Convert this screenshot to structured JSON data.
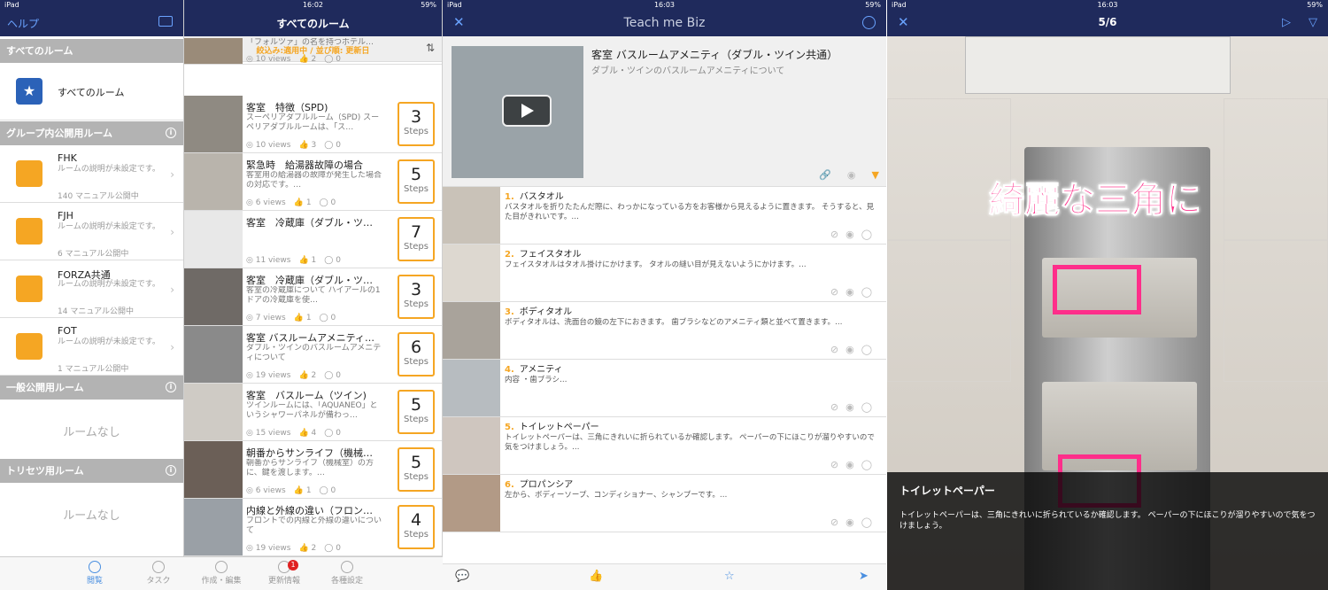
{
  "status": {
    "device": "iPad",
    "battery": "59%",
    "times": [
      "16:02",
      "16:03",
      "16:03"
    ]
  },
  "p1": {
    "help": "ヘルプ",
    "sections": {
      "all": "すべてのルーム",
      "group": "グループ内公開用ルーム",
      "public": "一般公開用ルーム",
      "torisetsu": "トリセツ用ルーム"
    },
    "all_room": "すべてのルーム",
    "rooms": [
      {
        "name": "FHK",
        "desc": "ルームの説明が未設定です。",
        "meta": "140 マニュアル公開中"
      },
      {
        "name": "FJH",
        "desc": "ルームの説明が未設定です。",
        "meta": "6 マニュアル公開中"
      },
      {
        "name": "FORZA共通",
        "desc": "ルームの説明が未設定です。",
        "meta": "14 マニュアル公開中"
      },
      {
        "name": "FOT",
        "desc": "ルームの説明が未設定です。",
        "meta": "1 マニュアル公開中"
      }
    ],
    "no_room": "ルームなし"
  },
  "tabs": [
    {
      "label": "閲覧"
    },
    {
      "label": "タスク"
    },
    {
      "label": "作成・編集"
    },
    {
      "label": "更新情報",
      "badge": "1"
    },
    {
      "label": "各種設定"
    }
  ],
  "p2": {
    "title": "すべてのルーム",
    "filter": "絞込み:適用中 / 並び順: 更新日",
    "steps_label": "Steps",
    "manuals": [
      {
        "title": "",
        "desc": "「フォルツァ」の名を持つホテル…",
        "views": "10 views",
        "likes": "2",
        "comments": "0"
      },
      {
        "title": "客室　特徴（SPD)",
        "desc": "スーペリアダブルルーム（SPD) スーペリアダブルルームは、「ス…",
        "views": "10 views",
        "likes": "3",
        "comments": "0",
        "steps": "3"
      },
      {
        "title": "緊急時　給湯器故障の場合",
        "desc": "客室用の給湯器の故障が発生した場合の対応です。…",
        "views": "6 views",
        "likes": "1",
        "comments": "0",
        "steps": "5"
      },
      {
        "title": "客室　冷蔵庫（ダブル・ツ…",
        "desc": "",
        "views": "11 views",
        "likes": "1",
        "comments": "0",
        "steps": "7"
      },
      {
        "title": "客室　冷蔵庫（ダブル・ツ…",
        "desc": "客室の冷蔵庫について ハイアールの1ドアの冷蔵庫を使…",
        "views": "7 views",
        "likes": "1",
        "comments": "0",
        "steps": "3"
      },
      {
        "title": "客室 バスルームアメニティ…",
        "desc": "ダブル・ツインのバスルームアメニティについて",
        "views": "19 views",
        "likes": "2",
        "comments": "0",
        "steps": "6"
      },
      {
        "title": "客室　バスルーム（ツイン)",
        "desc": "ツインルームには、「AQUANEO」というシャワーパネルが備わっ…",
        "views": "15 views",
        "likes": "4",
        "comments": "0",
        "steps": "5"
      },
      {
        "title": "朝番からサンライフ（機械…",
        "desc": "朝番からサンライフ（機械室）の方に、鍵を渡します。…",
        "views": "6 views",
        "likes": "1",
        "comments": "0",
        "steps": "5"
      },
      {
        "title": "内線と外線の違い（フロン…",
        "desc": "フロントでの内線と外線の違いについて",
        "views": "19 views",
        "likes": "2",
        "comments": "0",
        "steps": "4"
      }
    ]
  },
  "p3": {
    "logo": "Teach me Biz",
    "title": "客室 バスルームアメニティ（ダブル・ツイン共通）",
    "subtitle": "ダブル・ツインのバスルームアメニティについて",
    "steps": [
      {
        "num": "1.",
        "title": "バスタオル",
        "desc": "バスタオルを折りたたんだ際に、わっかになっている方をお客様から見えるように置きます。 そうすると、見た目がきれいです。…"
      },
      {
        "num": "2.",
        "title": "フェイスタオル",
        "desc": "フェイスタオルはタオル掛けにかけます。 タオルの縫い目が見えないようにかけます。…"
      },
      {
        "num": "3.",
        "title": "ボディタオル",
        "desc": "ボディタオルは、洗面台の鏡の左下におきます。 歯ブラシなどのアメニティ類と並べて置きます。…"
      },
      {
        "num": "4.",
        "title": "アメニティ",
        "desc": "内容 ・歯ブラシ…"
      },
      {
        "num": "5.",
        "title": "トイレットペーパー",
        "desc": "トイレットペーパーは、三角にきれいに折られているか確認します。 ペーパーの下にほこりが溜りやすいので気をつけましょう。…"
      },
      {
        "num": "6.",
        "title": "プロパンシア",
        "desc": "左から、ボディーソープ、コンディショナー、シャンプーです。…"
      }
    ]
  },
  "p4": {
    "page": "5/6",
    "overlay": "綺麗な三角に",
    "caption_title": "トイレットペーパー",
    "caption_desc": "トイレットペーパーは、三角にきれいに折られているか確認します。 ペーパーの下にほこりが溜りやすいので気をつけましょう。"
  }
}
